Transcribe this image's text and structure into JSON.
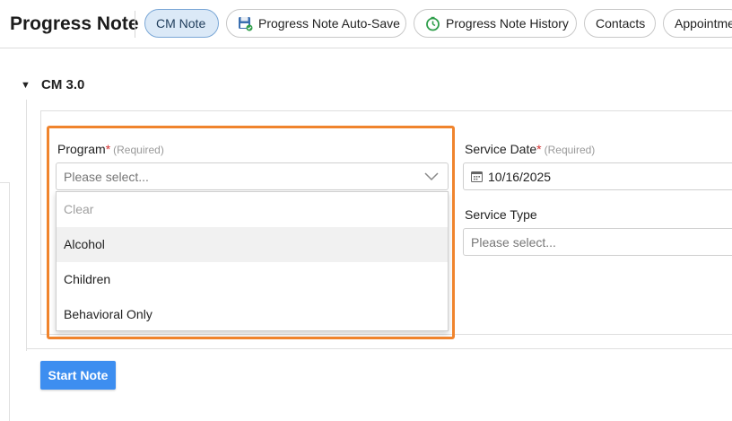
{
  "header": {
    "title": "Progress Note",
    "tabs": [
      {
        "label": "CM Note",
        "active": true
      },
      {
        "label": "Progress Note Auto-Save",
        "icon": "save-icon"
      },
      {
        "label": "Progress Note History",
        "icon": "history-icon"
      },
      {
        "label": "Contacts"
      },
      {
        "label": "Appointme"
      }
    ]
  },
  "section": {
    "title": "CM 3.0",
    "toggle": "▼"
  },
  "form": {
    "program": {
      "label": "Program",
      "required_mark": "*",
      "hint": "(Required)",
      "placeholder": "Please select...",
      "options": [
        "Clear",
        "Alcohol",
        "Children",
        "Behavioral Only"
      ]
    },
    "service_date": {
      "label": "Service Date",
      "required_mark": "*",
      "hint": "(Required)",
      "value": "10/16/2025"
    },
    "service_type": {
      "label": "Service Type",
      "placeholder": "Please select..."
    }
  },
  "actions": {
    "start_note": "Start Note"
  },
  "colors": {
    "accent": "#3d8ef0",
    "active_tab_bg": "#dbe9f7",
    "highlight": "#f0842d",
    "required": "#d32f2f"
  }
}
